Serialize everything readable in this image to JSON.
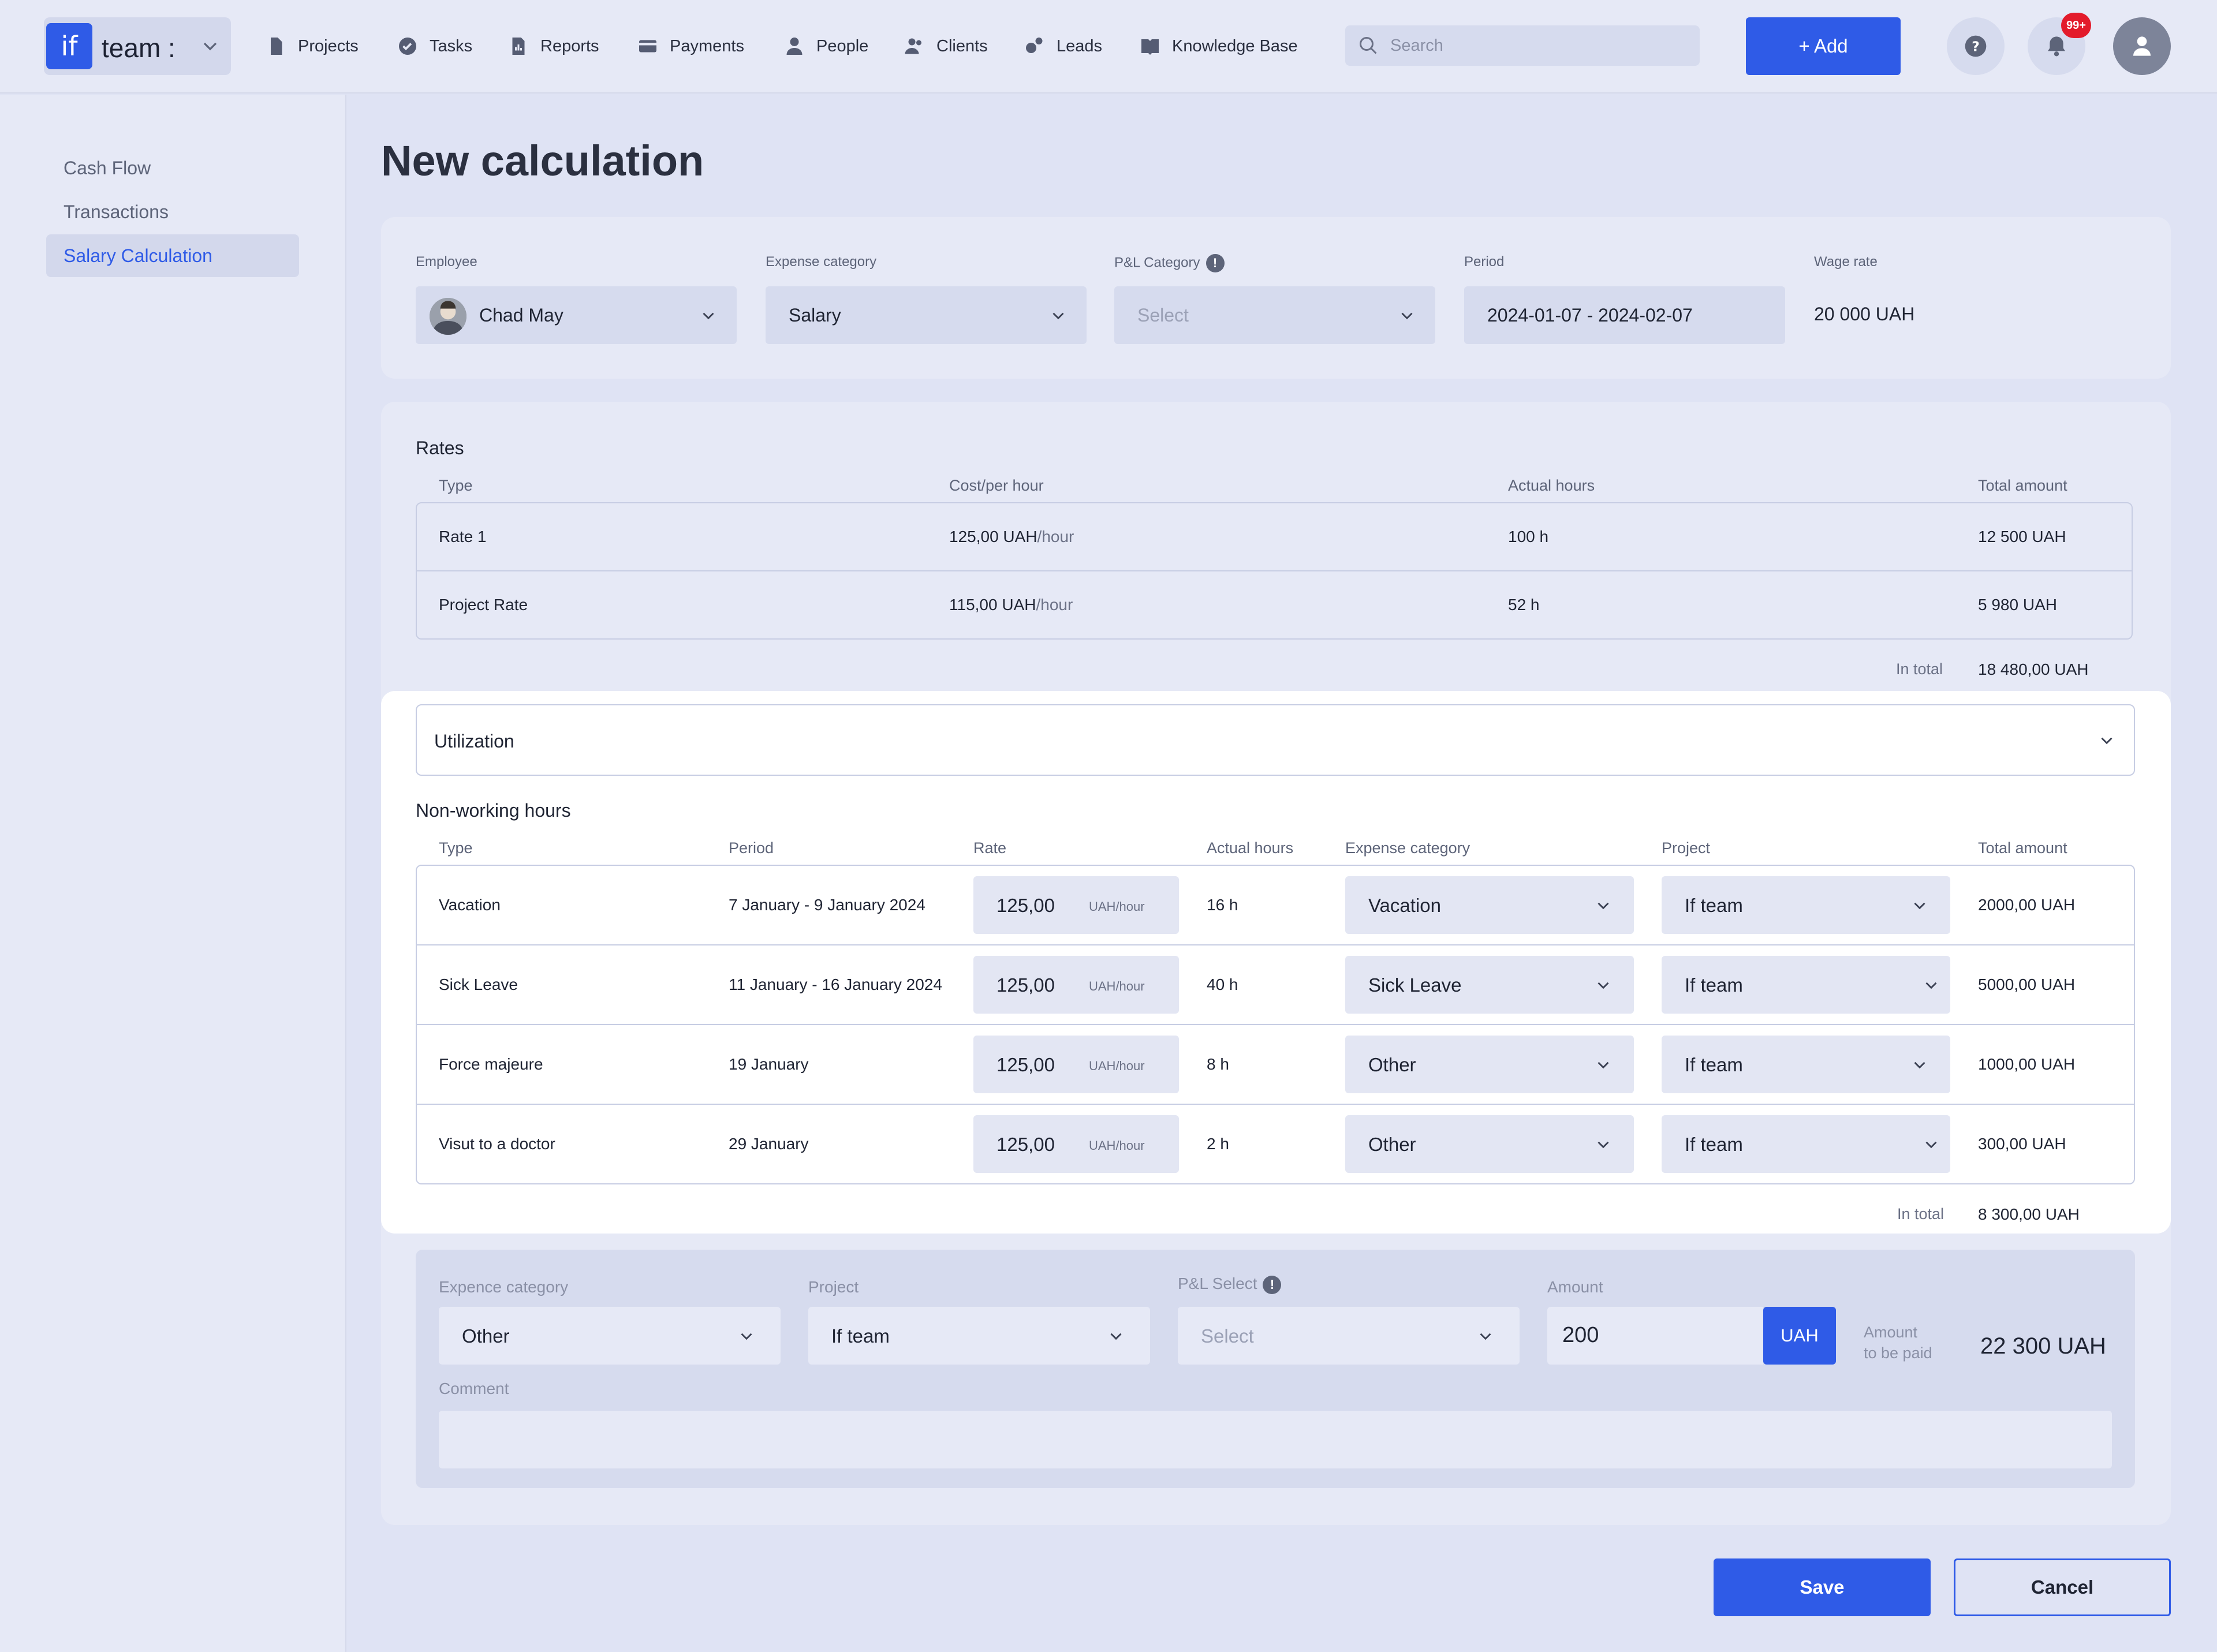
{
  "brand": {
    "logo_text": "if",
    "name": "team :"
  },
  "nav": [
    {
      "label": "Projects",
      "icon": "document-icon"
    },
    {
      "label": "Tasks",
      "icon": "check-circle-icon"
    },
    {
      "label": "Reports",
      "icon": "report-icon"
    },
    {
      "label": "Payments",
      "icon": "card-icon"
    },
    {
      "label": "People",
      "icon": "person-icon"
    },
    {
      "label": "Clients",
      "icon": "people-icon"
    },
    {
      "label": "Leads",
      "icon": "leads-icon"
    },
    {
      "label": "Knowledge Base",
      "icon": "book-icon"
    }
  ],
  "search": {
    "placeholder": "Search"
  },
  "add_label": "+ Add",
  "notifications": {
    "badge": "99+"
  },
  "sidebar": {
    "items": [
      {
        "label": "Cash Flow"
      },
      {
        "label": "Transactions"
      },
      {
        "label": "Salary Calculation",
        "active": true
      }
    ]
  },
  "page_title": "New calculation",
  "employee_form": {
    "employee_label": "Employee",
    "employee_value": "Chad May",
    "expense_label": "Expense category",
    "expense_value": "Salary",
    "pl_label": "P&L Category",
    "pl_placeholder": "Select",
    "period_label": "Period",
    "period_value": "2024-01-07 - 2024-02-07",
    "wage_label": "Wage rate",
    "wage_value": "20 000 UAH"
  },
  "rates": {
    "title": "Rates",
    "headers": {
      "type": "Type",
      "cost": "Cost/per hour",
      "hours": "Actual hours",
      "total": "Total amount"
    },
    "rows": [
      {
        "type": "Rate 1",
        "cost": "125,00 UAH",
        "unit": "/hour",
        "hours": "100 h",
        "total": "12 500 UAH"
      },
      {
        "type": "Project Rate",
        "cost": "115,00 UAH",
        "unit": "/hour",
        "hours": "52 h",
        "total": "5 980 UAH"
      }
    ],
    "total_label": "In total",
    "total_value": "18 480,00 UAH"
  },
  "utilization": {
    "label": "Utilization"
  },
  "non_working": {
    "title": "Non-working hours",
    "headers": {
      "type": "Type",
      "period": "Period",
      "rate": "Rate",
      "hours": "Actual hours",
      "expense": "Expense category",
      "project": "Project",
      "total": "Total amount"
    },
    "rows": [
      {
        "type": "Vacation",
        "period": "7 January - 9 January 2024",
        "rate": "125,00",
        "unit": "UAH/hour",
        "hours": "16 h",
        "expense": "Vacation",
        "project": "If team",
        "total": "2000,00 UAH"
      },
      {
        "type": "Sick Leave",
        "period": "11 January - 16 January 2024",
        "rate": "125,00",
        "unit": "UAH/hour",
        "hours": "40 h",
        "expense": "Sick Leave",
        "project": "If team",
        "total": "5000,00 UAH"
      },
      {
        "type": "Force majeure",
        "period": "19 January",
        "rate": "125,00",
        "unit": "UAH/hour",
        "hours": "8 h",
        "expense": "Other",
        "project": "If team",
        "total": "1000,00 UAH"
      },
      {
        "type": "Visut to a doctor",
        "period": "29 January",
        "rate": "125,00",
        "unit": "UAH/hour",
        "hours": "2 h",
        "expense": "Other",
        "project": "If team",
        "total": "300,00 UAH"
      }
    ],
    "total_label": "In total",
    "total_value": "8 300,00 UAH"
  },
  "extra": {
    "expense_label": "Expence category",
    "expense_value": "Other",
    "project_label": "Project",
    "project_value": "If team",
    "pl_label": "P&L Select",
    "pl_placeholder": "Select",
    "amount_label": "Amount",
    "amount_value": "200",
    "currency": "UAH",
    "to_be_paid_line1": "Amount",
    "to_be_paid_line2": "to be paid",
    "to_be_paid_value": "22 300 UAH",
    "comment_label": "Comment",
    "comment_value": ""
  },
  "actions": {
    "save": "Save",
    "cancel": "Cancel"
  },
  "colors": {
    "accent": "#2f5be7",
    "badge": "#e31b2b",
    "background": "#dfe3f4"
  }
}
